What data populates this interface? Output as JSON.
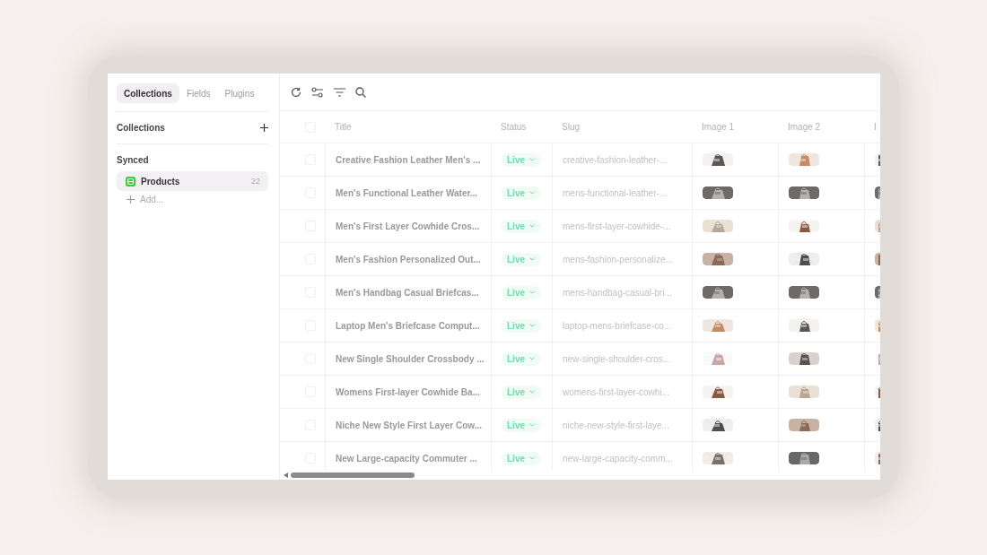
{
  "sidebar": {
    "tabs": [
      {
        "label": "Collections",
        "selected": true
      },
      {
        "label": "Fields",
        "selected": false
      },
      {
        "label": "Plugins",
        "selected": false
      }
    ],
    "collections_header": "Collections",
    "sections": [
      {
        "title": "Synced",
        "items": [
          {
            "label": "Products",
            "count": "22",
            "selected": true
          }
        ],
        "add_label": "Add..."
      }
    ]
  },
  "table": {
    "header_checkbox": {
      "checked": false
    },
    "columns": [
      "Title",
      "Status",
      "Slug",
      "Image 1",
      "Image 2",
      "I"
    ],
    "rows": [
      {
        "selected": false,
        "title": "Creative Fashion Leather Men's ...",
        "status": "Live",
        "slug": "creative-fashion-leather-..."
      },
      {
        "selected": false,
        "title": "Men's Functional Leather Water...",
        "status": "Live",
        "slug": "mens-functional-leather-..."
      },
      {
        "selected": false,
        "title": "Men's First Layer Cowhide Cros...",
        "status": "Live",
        "slug": "mens-first-layer-cowhide-..."
      },
      {
        "selected": false,
        "title": "Men's Fashion Personalized Out...",
        "status": "Live",
        "slug": "mens-fashion-personalize..."
      },
      {
        "selected": false,
        "title": "Men's Handbag Casual Briefcas...",
        "status": "Live",
        "slug": "mens-handbag-casual-bri..."
      },
      {
        "selected": false,
        "title": "Laptop Men's Briefcase Comput...",
        "status": "Live",
        "slug": "laptop-mens-briefcase-co..."
      },
      {
        "selected": false,
        "title": "New Single Shoulder Crossbody ...",
        "status": "Live",
        "slug": "new-single-shoulder-cros..."
      },
      {
        "selected": false,
        "title": "Womens First-layer Cowhide Ba...",
        "status": "Live",
        "slug": "womens-first-layer-cowhi..."
      },
      {
        "selected": false,
        "title": "Niche New Style First Layer Cow...",
        "status": "Live",
        "slug": "niche-new-style-first-laye..."
      },
      {
        "selected": false,
        "title": "New Large-capacity Commuter ...",
        "status": "Live",
        "slug": "new-large-capacity-comm..."
      }
    ]
  }
}
